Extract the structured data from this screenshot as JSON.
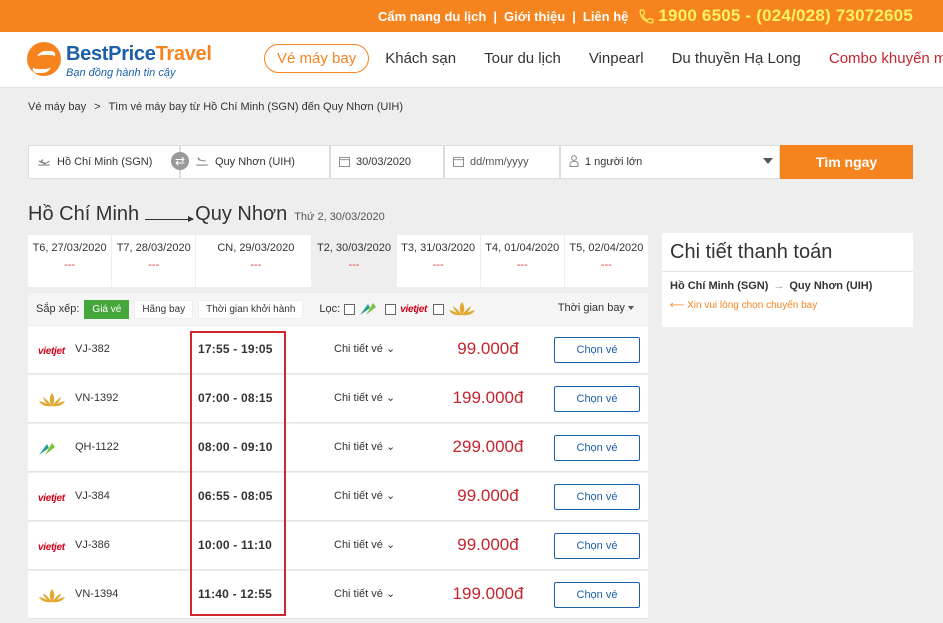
{
  "topbar": {
    "guide": "Cẩm nang du lịch",
    "about": "Giới thiệu",
    "contact": "Liên hệ",
    "phone": "1900 6505 - (024/028) 73072605",
    "phone_icon": "phone-icon"
  },
  "header": {
    "logo_brand_a": "BestPrice",
    "logo_brand_b": "Travel",
    "logo_tagline": "Bạn đồng hành tin cậy",
    "nav": [
      "Vé máy bay",
      "Khách sạn",
      "Tour du lịch",
      "Vinpearl",
      "Du thuyền Hạ Long",
      "Combo khuyến mại"
    ]
  },
  "breadcrumb": {
    "home": "Vé máy bay",
    "current": "Tìm vé máy bay từ Hồ Chí Minh (SGN) đến Quy Nhơn (UIH)"
  },
  "search": {
    "origin": "Hồ Chí Minh (SGN)",
    "destination": "Quy Nhơn (UIH)",
    "depart_date": "30/03/2020",
    "return_placeholder": "dd/mm/yyyy",
    "passengers": "1 người lớn",
    "button": "Tìm ngay"
  },
  "route": {
    "from": "Hồ Chí Minh",
    "to": "Quy Nhơn",
    "date": "Thứ 2, 30/03/2020"
  },
  "dates": [
    {
      "label": "T6, 27/03/2020",
      "price": "---"
    },
    {
      "label": "T7, 28/03/2020",
      "price": "---"
    },
    {
      "label": "CN, 29/03/2020",
      "price": "---"
    },
    {
      "label": "T2, 30/03/2020",
      "price": "---"
    },
    {
      "label": "T3, 31/03/2020",
      "price": "---"
    },
    {
      "label": "T4, 01/04/2020",
      "price": "---"
    },
    {
      "label": "T5, 02/04/2020",
      "price": "---"
    }
  ],
  "sortbar": {
    "sort_label": "Sắp xếp:",
    "by_price": "Giá vé",
    "by_airline": "Hãng bay",
    "by_departure": "Thời gian khởi hành",
    "filter_label": "Lọc:",
    "vietjet_label": "vietjet",
    "flight_time": "Thời gian bay"
  },
  "flights": [
    {
      "airline": "vietjet",
      "code": "VJ-382",
      "time": "17:55 - 19:05",
      "detail": "Chi tiết vé",
      "price": "99.000đ",
      "choose": "Chọn vé"
    },
    {
      "airline": "vietnam-airlines",
      "code": "VN-1392",
      "time": "07:00 - 08:15",
      "detail": "Chi tiết vé",
      "price": "199.000đ",
      "choose": "Chọn vé"
    },
    {
      "airline": "bamboo",
      "code": "QH-1122",
      "time": "08:00 - 09:10",
      "detail": "Chi tiết vé",
      "price": "299.000đ",
      "choose": "Chọn vé"
    },
    {
      "airline": "vietjet",
      "code": "VJ-384",
      "time": "06:55 - 08:05",
      "detail": "Chi tiết vé",
      "price": "99.000đ",
      "choose": "Chọn vé"
    },
    {
      "airline": "vietjet",
      "code": "VJ-386",
      "time": "10:00 - 11:10",
      "detail": "Chi tiết vé",
      "price": "99.000đ",
      "choose": "Chọn vé"
    },
    {
      "airline": "vietnam-airlines",
      "code": "VN-1394",
      "time": "11:40 - 12:55",
      "detail": "Chi tiết vé",
      "price": "199.000đ",
      "choose": "Chọn vé"
    }
  ],
  "payment": {
    "title": "Chi tiết thanh toán",
    "from": "Hồ Chí Minh (SGN)",
    "to": "Quy Nhơn (UIH)",
    "note": "Xin vui lòng chọn chuyến bay"
  },
  "colors": {
    "brand_orange": "#f5841f",
    "brand_blue": "#1b5fa8",
    "price_red": "#c5252f",
    "highlight_red": "#d0262d"
  }
}
